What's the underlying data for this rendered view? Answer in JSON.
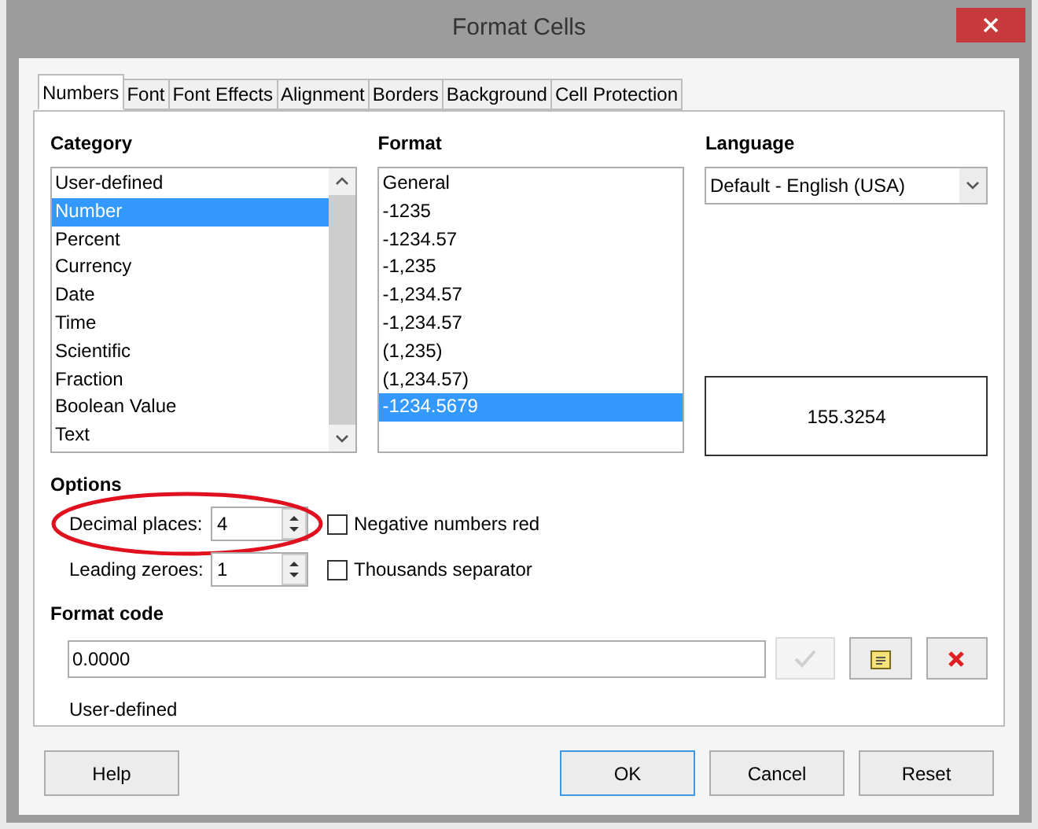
{
  "window": {
    "title": "Format Cells"
  },
  "tabs": [
    {
      "label": "Numbers",
      "selected": true
    },
    {
      "label": "Font",
      "selected": false
    },
    {
      "label": "Font Effects",
      "selected": false
    },
    {
      "label": "Alignment",
      "selected": false
    },
    {
      "label": "Borders",
      "selected": false
    },
    {
      "label": "Background",
      "selected": false
    },
    {
      "label": "Cell Protection",
      "selected": false
    }
  ],
  "category": {
    "label": "Category",
    "items": [
      {
        "label": "User-defined",
        "selected": false
      },
      {
        "label": "Number",
        "selected": true
      },
      {
        "label": "Percent",
        "selected": false
      },
      {
        "label": "Currency",
        "selected": false
      },
      {
        "label": "Date",
        "selected": false
      },
      {
        "label": "Time",
        "selected": false
      },
      {
        "label": "Scientific",
        "selected": false
      },
      {
        "label": "Fraction",
        "selected": false
      },
      {
        "label": "Boolean Value",
        "selected": false
      },
      {
        "label": "Text",
        "selected": false
      }
    ]
  },
  "format": {
    "label": "Format",
    "items": [
      {
        "label": "General",
        "selected": false
      },
      {
        "label": "-1235",
        "selected": false
      },
      {
        "label": "-1234.57",
        "selected": false
      },
      {
        "label": "-1,235",
        "selected": false
      },
      {
        "label": "-1,234.57",
        "selected": false
      },
      {
        "label": "-1,234.57",
        "selected": false
      },
      {
        "label": "(1,235)",
        "selected": false
      },
      {
        "label": "(1,234.57)",
        "selected": false
      },
      {
        "label": "-1234.5679",
        "selected": true
      }
    ]
  },
  "language": {
    "label": "Language",
    "value": "Default - English (USA)"
  },
  "preview": "155.3254",
  "options": {
    "label": "Options",
    "spinners": [
      {
        "label": "Decimal places:",
        "value": "4",
        "highlighted": true
      },
      {
        "label": "Leading zeroes:",
        "value": "1",
        "highlighted": false
      }
    ],
    "checkboxes": [
      {
        "label": "Negative numbers red",
        "checked": false
      },
      {
        "label": "Thousands separator",
        "checked": false
      }
    ]
  },
  "format_code": {
    "label": "Format code",
    "value": "0.0000",
    "description": "User-defined"
  },
  "highlight": {
    "color": "#e0101e"
  },
  "buttons": [
    {
      "label": "Help",
      "default": false
    },
    {
      "label": "OK",
      "default": true
    },
    {
      "label": "Cancel",
      "default": false
    },
    {
      "label": "Reset",
      "default": false
    }
  ]
}
